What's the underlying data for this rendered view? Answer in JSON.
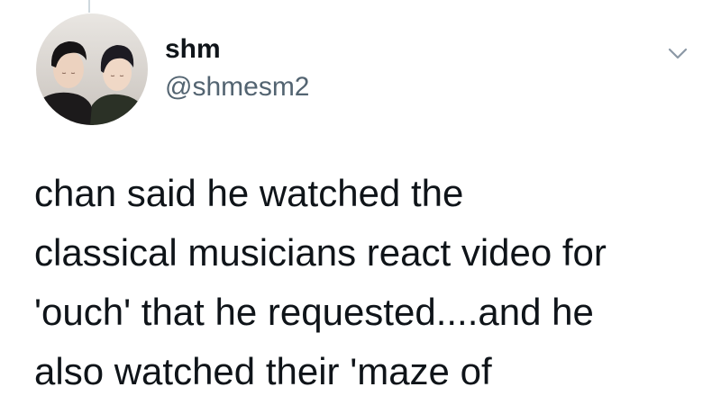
{
  "tweet": {
    "author": {
      "display_name": "shm",
      "handle": "@shmesm2",
      "avatar_icon": "profile-photo-two-people"
    },
    "menu_icon": "chevron-down-icon",
    "text_lines": [
      "chan said he watched the",
      "classical musicians react video for",
      "'ouch' that he requested....and he",
      "also watched their 'maze of"
    ]
  },
  "colors": {
    "text_primary": "#0f1419",
    "text_secondary": "#536471",
    "chevron": "#8b98a5",
    "background": "#ffffff"
  }
}
